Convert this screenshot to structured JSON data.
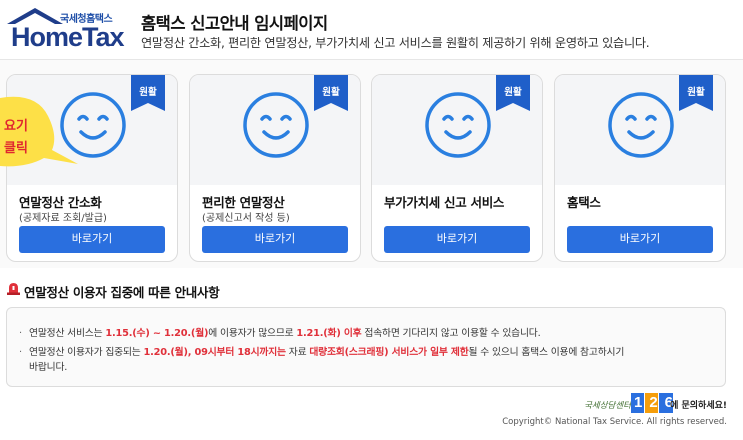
{
  "header": {
    "logo_top": "국세청홈택스",
    "logo_main": "HomeTax",
    "title": "홈택스 신고안내 임시페이지",
    "subtitle": "연말정산 간소화, 편리한 연말정산, 부가가치세 신고 서비스를 원활히 제공하기 위해 운영하고 있습니다."
  },
  "bubble_text": "요기 클릭",
  "cards": [
    {
      "status": "원활",
      "title": "연말정산 간소화",
      "sub": "(공제자료 조회/발급)",
      "button": "바로가기"
    },
    {
      "status": "원활",
      "title": "편리한 연말정산",
      "sub": "(공제신고서 작성 등)",
      "button": "바로가기"
    },
    {
      "status": "원활",
      "title": "부가가치세 신고 서비스",
      "sub": "",
      "button": "바로가기"
    },
    {
      "status": "원활",
      "title": "홈택스",
      "sub": "",
      "button": "바로가기"
    }
  ],
  "notice": {
    "title": "연말정산 이용자 집중에 따른 안내사항",
    "line1": {
      "a": "연말정산 서비스는 ",
      "b": "1.15.(수) ~ 1.20.(월)",
      "c": "에 이용자가 많으므로 ",
      "d": "1.21.(화) 이후",
      "e": " 접속하면 기다리지 않고 이용할 수 있습니다."
    },
    "line2": {
      "a": "연말정산 이용자가 집중되는 ",
      "b": "1.20.(월), 09시부터 18시까지는",
      "c": " 자료 ",
      "d": "대량조회(스크래핑) 서비스가 일부 제한",
      "e": "될 수 있으니 홈택스 이용에 참고하시기"
    },
    "line3": "바랍니다."
  },
  "footer": {
    "script": "국세상담센터",
    "number": "126",
    "contact": "에 문의하세요!",
    "copyright": "Copyright© National Tax Service. All rights reserved."
  },
  "colors": {
    "brand_navy": "#1f3d8a",
    "button_blue": "#2a6fdf",
    "ribbon_blue": "#1f5fc9",
    "alert_red": "#e0303a",
    "bubble_yellow": "#fde047"
  }
}
